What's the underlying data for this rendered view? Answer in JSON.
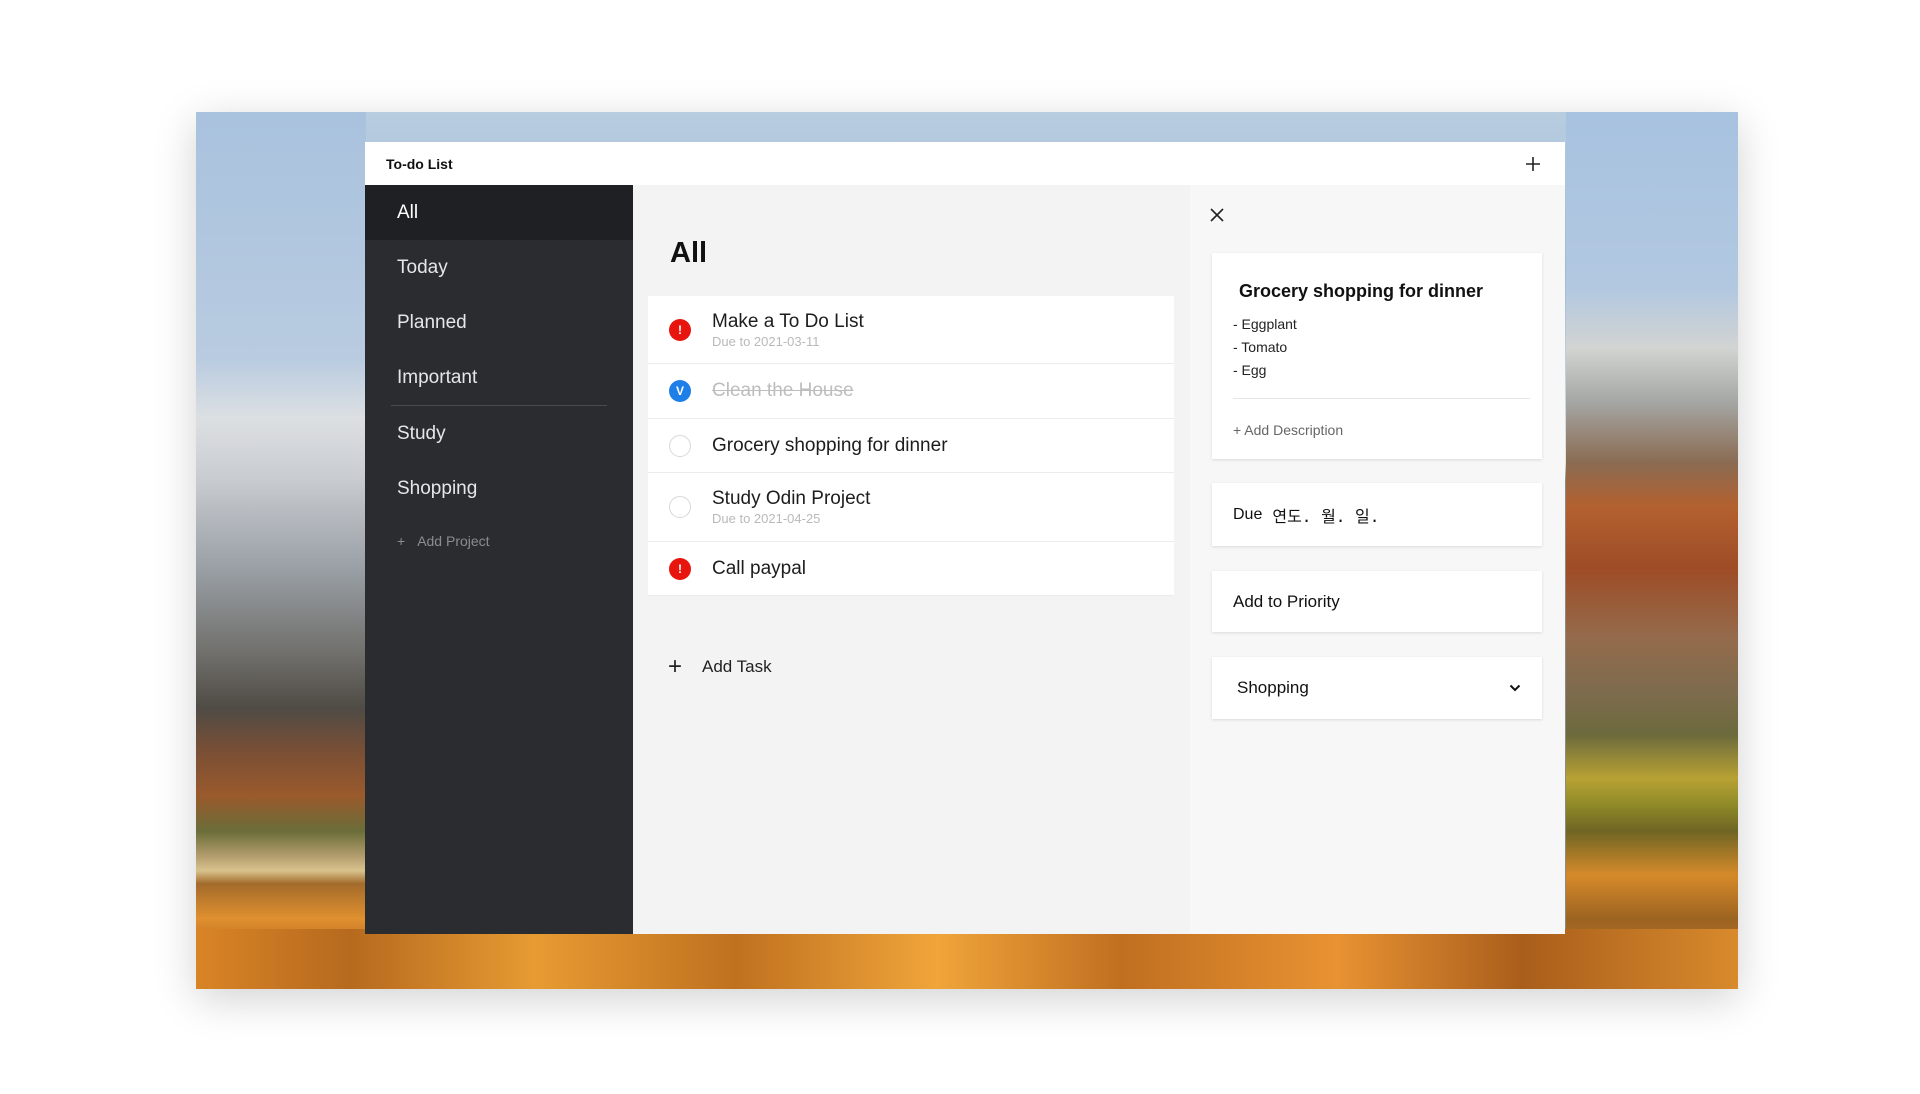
{
  "window": {
    "title": "To-do List"
  },
  "sidebar": {
    "items": [
      {
        "label": "All"
      },
      {
        "label": "Today"
      },
      {
        "label": "Planned"
      },
      {
        "label": "Important"
      }
    ],
    "projects": [
      {
        "label": "Study"
      },
      {
        "label": "Shopping"
      }
    ],
    "add_project_label": "Add Project",
    "add_project_icon": "+"
  },
  "main": {
    "title": "All",
    "tasks": [
      {
        "name": "Make a To Do List",
        "due": "Due to 2021-03-11",
        "state": "important",
        "marker": "!"
      },
      {
        "name": "Clean the House",
        "due": "",
        "state": "done",
        "marker": "V"
      },
      {
        "name": "Grocery shopping for dinner",
        "due": "",
        "state": "open",
        "marker": ""
      },
      {
        "name": "Study Odin Project",
        "due": "Due to 2021-04-25",
        "state": "open",
        "marker": ""
      },
      {
        "name": "Call paypal",
        "due": "",
        "state": "important",
        "marker": "!"
      }
    ],
    "add_task_label": "Add Task",
    "add_task_icon": "+"
  },
  "detail": {
    "task_title": "Grocery shopping for dinner",
    "description_items": [
      "- Eggplant",
      "- Tomato",
      "- Egg"
    ],
    "add_description_label": "+ Add Description",
    "due_label": "Due",
    "due_value": "연도. 월. 일.",
    "priority_label": "Add to Priority",
    "project_value": "Shopping"
  },
  "colors": {
    "sidebar_bg": "#2b2c30",
    "sidebar_active_bg": "#1f2023",
    "important_marker": "#e8140e",
    "done_marker": "#1f7fe8",
    "main_bg": "#f3f3f3"
  }
}
